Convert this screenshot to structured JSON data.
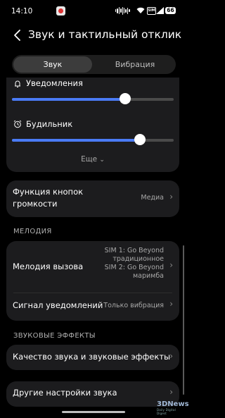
{
  "status_bar": {
    "time": "14:10",
    "battery": "66"
  },
  "header": {
    "title": "Звук и тактильный отклик"
  },
  "tabs": [
    {
      "label": "Звук",
      "active": true
    },
    {
      "label": "Вибрация",
      "active": false
    }
  ],
  "volume": {
    "notifications": {
      "label": "Уведомления",
      "level": 0.7
    },
    "alarm": {
      "label": "Будильник",
      "level": 0.79
    },
    "more_label": "Еще"
  },
  "volume_buttons": {
    "title_line1": "Функция кнопок",
    "title_line2": "громкости",
    "value": "Медиа"
  },
  "melody_section": {
    "header": "МЕЛОДИЯ",
    "ringtone": {
      "title": "Мелодия вызова",
      "value_lines": [
        "SIM 1: Go Beyond",
        "традиционное",
        "SIM 2: Go Beyond",
        "маримба"
      ]
    },
    "notification_signal": {
      "title": "Сигнал уведомлений",
      "value": "Только вибрация"
    }
  },
  "effects_section": {
    "header": "ЗВУКОВЫЕ ЭФФЕКТЫ",
    "quality": {
      "title": "Качество звука и звуковые эффекты"
    }
  },
  "other": {
    "title": "Другие настройки звука"
  },
  "watermark": {
    "brand": "3DNews",
    "tagline": "Daily Digital Digest"
  },
  "colors": {
    "accent": "#4a7bf5",
    "card": "#1c1c1e",
    "background": "#000000"
  }
}
